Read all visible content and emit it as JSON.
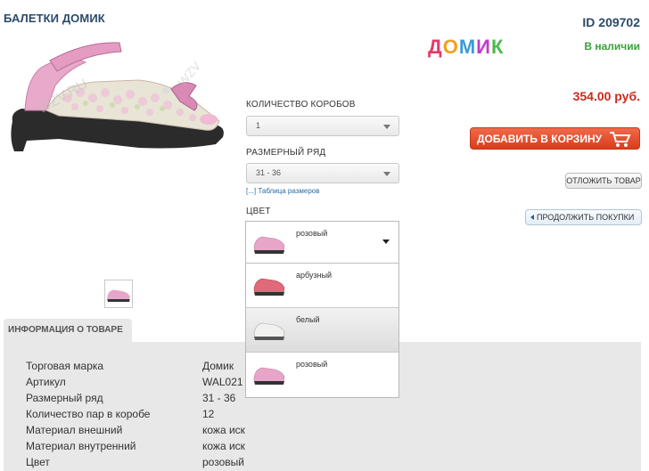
{
  "product": {
    "title": "БАЛЕТКИ ДОМИК",
    "id_label": "ID 209702",
    "brand_logo": "домик",
    "stock_status": "В наличии",
    "price": "354.00 руб."
  },
  "actions": {
    "add_to_cart": "ДОБАВИТЬ В КОРЗИНУ",
    "defer": "ОТЛОЖИТЬ ТОВАР",
    "continue": "ПРОДОЛЖИТЬ ПОКУПКИ"
  },
  "options": {
    "boxes_label": "КОЛИЧЕСТВО КОРОБОВ",
    "boxes_value": "1",
    "size_label": "РАЗМЕРНЫЙ РЯД",
    "size_value": "31 - 36",
    "size_table_link": "[...] Таблица размеров",
    "color_label": "ЦВЕТ",
    "color_selected": "розовый",
    "color_options": [
      "арбузный",
      "белый",
      "розовый"
    ]
  },
  "info": {
    "tab_label": "ИНФОРМАЦИЯ О ТОВАРЕ",
    "specs": [
      {
        "name": "Торговая марка",
        "value": "Домик"
      },
      {
        "name": "Артикул",
        "value": "WAL021"
      },
      {
        "name": "Размерный ряд",
        "value": "31 - 36"
      },
      {
        "name": "Количество пар в коробе",
        "value": "12"
      },
      {
        "name": "Материал внешний",
        "value": "кожа иск"
      },
      {
        "name": "Материал внутренний",
        "value": "кожа иск"
      },
      {
        "name": "Цвет",
        "value": "розовый"
      }
    ]
  },
  "colors": {
    "title": "#2a4a6b",
    "price": "#cc2a1a",
    "stock": "#3aa23a",
    "cart_button": "#e04a2a",
    "shoe_pink": "#e7a6c9",
    "shoe_watermelon": "#e06a7a",
    "shoe_white": "#f1f1ef"
  },
  "icons": {
    "cart": "shopping-cart-icon",
    "dropdown": "chevron-down-icon",
    "back": "arrow-left-icon"
  }
}
